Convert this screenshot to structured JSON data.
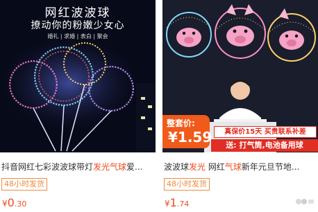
{
  "products": [
    {
      "image": {
        "headline": "网红波波球",
        "subhead": "撩动你的粉嫩少女心",
        "tags": "婚礼 | 求婚 | 表白 | 聚会"
      },
      "title_plain": "抖音网红七彩波波球带灯",
      "title_highlight": "发光气球",
      "title_tail": "爱...",
      "ship_badge": "48小时发货",
      "price": {
        "currency": "¥",
        "integer": "0",
        "decimal": ".30"
      }
    },
    {
      "image": {
        "promo_label": "整套价:",
        "promo_amount": "¥1.59",
        "guarantee": "真保价15天 买贵联系补差",
        "gift": "送: 打气筒,电池备用球"
      },
      "title_plain": "波波球",
      "title_highlight": "发光",
      "title_mid": " 网红",
      "title_highlight2": "气球",
      "title_tail": "新年元旦节地...",
      "ship_badge": "48小时发货",
      "price": {
        "currency": "¥",
        "integer": "1",
        "decimal": ".74"
      }
    }
  ],
  "colors": {
    "accent": "#f04a1e",
    "badge": "#f08a3c",
    "promo_red": "#e02e24"
  }
}
